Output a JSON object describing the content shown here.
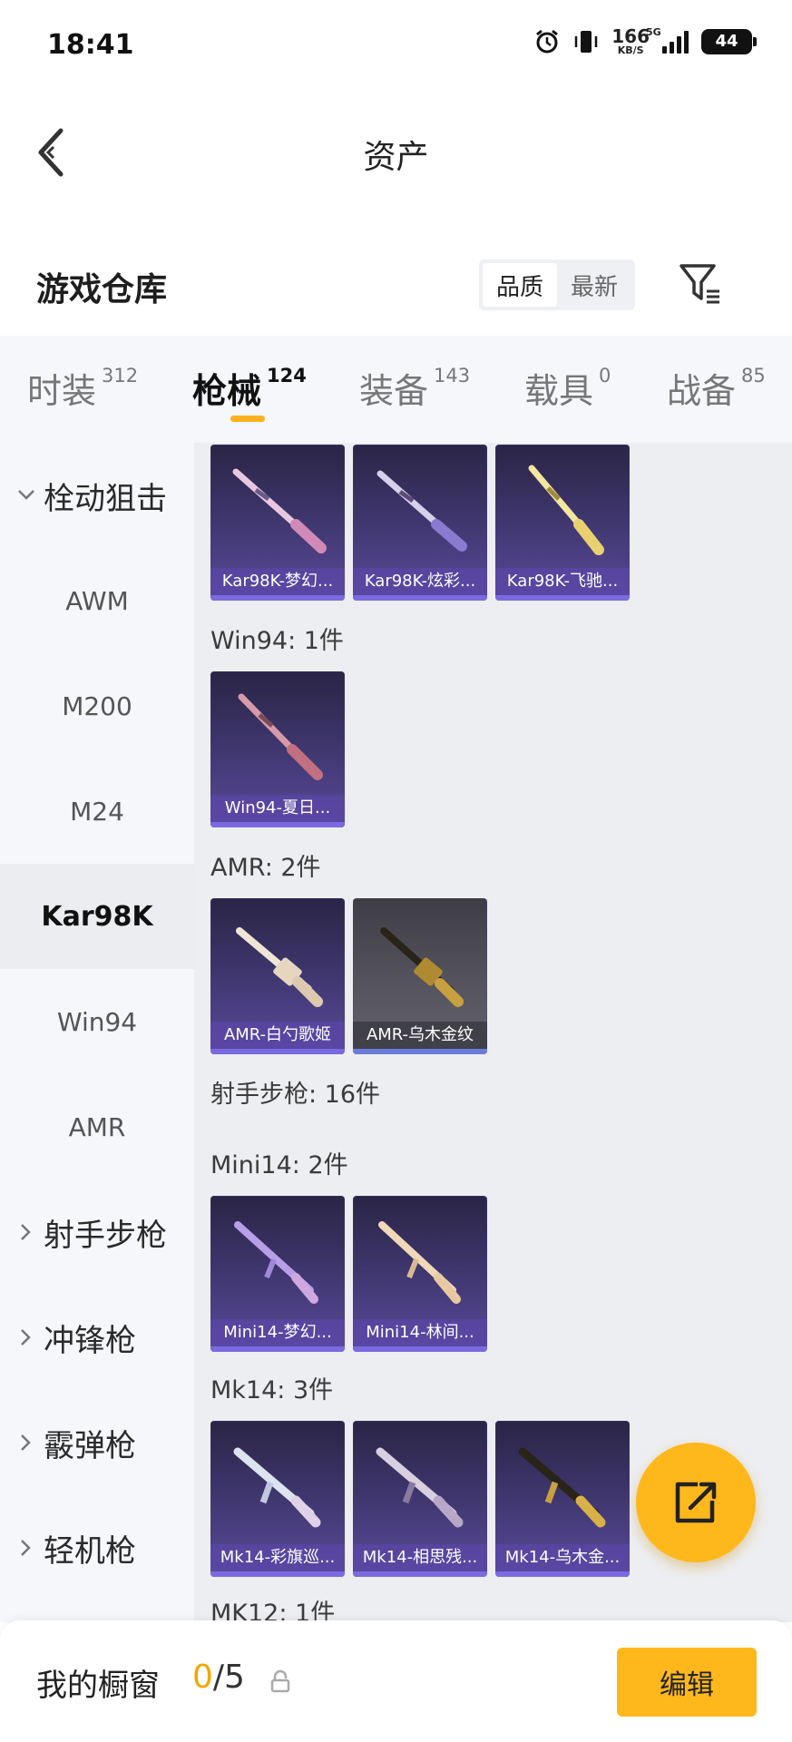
{
  "status_bar": {
    "time": "18:41",
    "net_speed_value": "166",
    "net_speed_unit": "KB/S",
    "network_type": "5G",
    "battery": "44",
    "icons": [
      "alarm-icon",
      "vibrate-icon",
      "signal-icon",
      "battery-icon"
    ]
  },
  "header": {
    "title": "资产",
    "back_icon": "chevron-left-icon"
  },
  "warehouse": {
    "title": "游戏仓库",
    "sort_options": [
      "品质",
      "最新"
    ],
    "sort_selected": "品质",
    "filter_icon": "filter-icon"
  },
  "tabs": [
    {
      "label": "时装",
      "count": "312"
    },
    {
      "label": "枪械",
      "count": "124"
    },
    {
      "label": "装备",
      "count": "143"
    },
    {
      "label": "载具",
      "count": "0"
    },
    {
      "label": "战备",
      "count": "85"
    }
  ],
  "active_tab": "枪械",
  "sidebar": {
    "groups": [
      {
        "label": "栓动狙击",
        "expanded": true,
        "children": [
          "AWM",
          "M200",
          "M24",
          "Kar98K",
          "Win94",
          "AMR"
        ]
      },
      {
        "label": "射手步枪",
        "expanded": false
      },
      {
        "label": "冲锋枪",
        "expanded": false
      },
      {
        "label": "霰弹枪",
        "expanded": false
      },
      {
        "label": "轻机枪",
        "expanded": false
      }
    ],
    "selected": "Kar98K"
  },
  "content": {
    "kar98k_items": [
      "Kar98K-梦幻...",
      "Kar98K-炫彩...",
      "Kar98K-飞驰..."
    ],
    "win94_label": "Win94: 1件",
    "win94_items": [
      "Win94-夏日..."
    ],
    "amr_label": "AMR: 2件",
    "amr_items": [
      "AMR-白勺歌姬",
      "AMR-乌木金纹"
    ],
    "dmr_label": "射手步枪: 16件",
    "mini14_label": "Mini14: 2件",
    "mini14_items": [
      "Mini14-梦幻...",
      "Mini14-林间..."
    ],
    "mk14_label": "Mk14: 3件",
    "mk14_items": [
      "Mk14-彩旗巡...",
      "Mk14-相思残...",
      "Mk14-乌木金..."
    ],
    "mk12_label": "MK12: 1件"
  },
  "fab": {
    "icon": "share-icon"
  },
  "bottom_bar": {
    "label": "我的橱窗",
    "current": "0",
    "separator": "/",
    "max": "5",
    "lock_icon": "lock-icon",
    "edit_label": "编辑"
  },
  "colors": {
    "accent": "#ffb81c",
    "count_highlight": "#f0a800",
    "card_purple": "#3d356b"
  }
}
